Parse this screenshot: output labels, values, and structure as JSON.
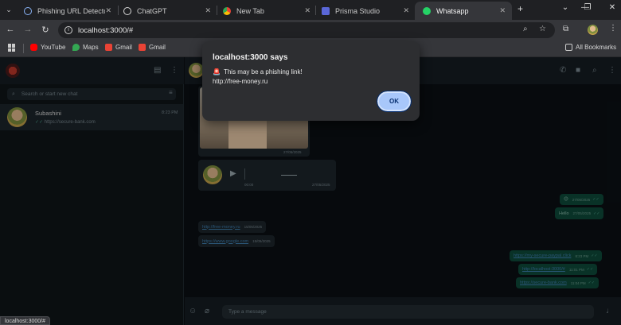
{
  "browser": {
    "tabs": [
      {
        "label": "Phishing URL Detector",
        "favicon_color": "#8ab4f8"
      },
      {
        "label": "ChatGPT",
        "favicon_color": "#d9d9d9"
      },
      {
        "label": "New Tab",
        "favicon_color": "#c3c3c3"
      },
      {
        "label": "Prisma Studio",
        "favicon_color": "#5a67d8"
      },
      {
        "label": "Whatsapp",
        "favicon_color": "#25d366"
      }
    ],
    "tab_close": "✕",
    "new_tab": "+",
    "window_controls": {
      "tab_search": "⌄",
      "minimize": "—",
      "maximize": "❐",
      "close": "✕"
    },
    "address": "localhost:3000/#",
    "bookmarks": [
      {
        "label": "YouTube",
        "icon": "youtube-icon",
        "color": "#ff0000"
      },
      {
        "label": "Maps",
        "icon": "maps-icon",
        "color": "#34a853"
      },
      {
        "label": "Gmail",
        "icon": "gmail-icon",
        "color": "#ea4335"
      },
      {
        "label": "Gmail",
        "icon": "gmail-icon",
        "color": "#ea4335"
      }
    ],
    "all_bookmarks": "All Bookmarks",
    "status_url": "localhost:3000/#"
  },
  "whatsapp": {
    "search_placeholder": "Search or start new chat",
    "chat": {
      "name": "Subashini",
      "preview": "https://secure-bank.com",
      "time": "8:23 PM"
    },
    "audio": {
      "duration": "00:00",
      "time": "27/05/2025"
    },
    "image_time": "27/05/2025",
    "messages_in": [
      {
        "link": "http://free-money.ru",
        "time": "15/05/2025"
      },
      {
        "link": "https://www.google.com",
        "time": "15/05/2025"
      }
    ],
    "messages_out": [
      {
        "text": "😊",
        "time": "27/05/2025"
      },
      {
        "text": "Hello",
        "time": "27/05/2025"
      },
      {
        "link": "https://my-secure-paypal.click",
        "time": "8:23 PM"
      },
      {
        "link": "http://localhost:3000/#",
        "time": "11:01 PM"
      },
      {
        "link": "https://secure-bank.com",
        "time": "11:04 PM"
      }
    ],
    "composer_placeholder": "Type a message"
  },
  "dialog": {
    "title": "localhost:3000 says",
    "message_icon": "🚨",
    "message": "This may be a phishing link!",
    "url": "http://free-money.ru",
    "ok_label": "OK"
  },
  "colors": {
    "accent": "#a8c7fa",
    "outgoing_bubble": "#0e4a3a",
    "incoming_bubble": "#1c252b"
  }
}
